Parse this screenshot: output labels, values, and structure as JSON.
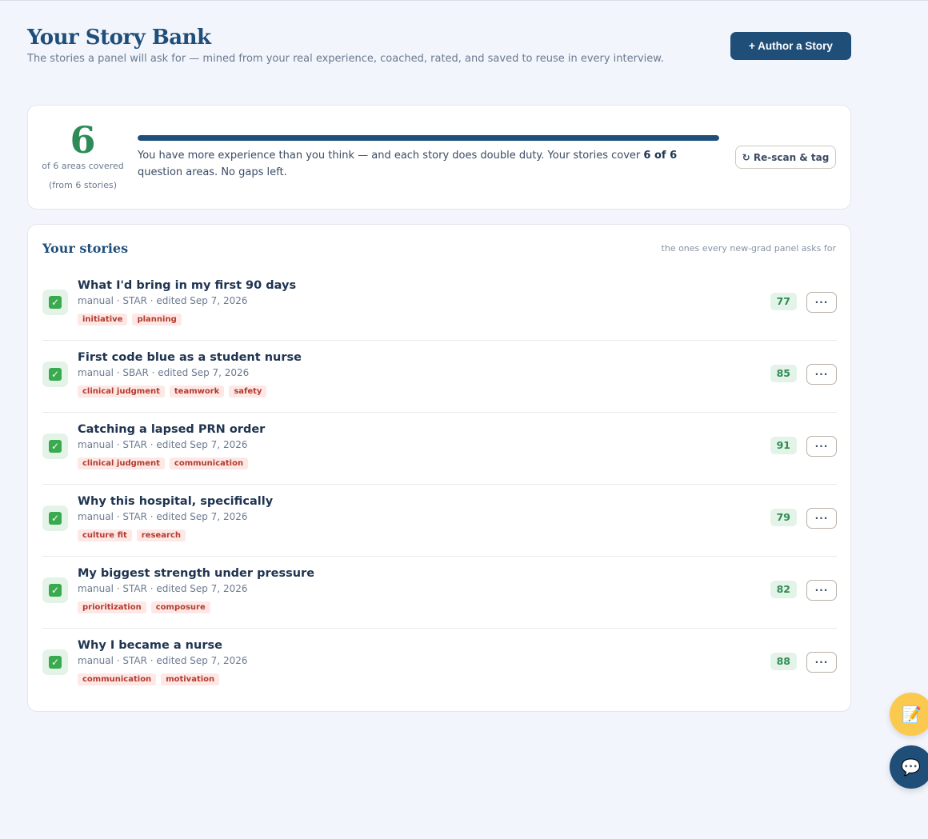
{
  "header": {
    "title": "Your Story Bank",
    "subtitle": "The stories a panel will ask for — mined from your real experience, coached, rated, and saved to reuse in every interview.",
    "author_button": "+ Author a Story"
  },
  "coverage": {
    "covered": "6",
    "areas_text": "of 6 areas covered",
    "from_text": "(from 6 stories)",
    "progress_fraction": 1.0,
    "message_before": "You have more experience than you think — and each story does double duty. Your stories cover ",
    "message_bold": "6 of 6",
    "message_after": " question areas. No gaps left.",
    "rescan_button": "↻ Re-scan & tag"
  },
  "stories": {
    "title": "Your stories",
    "hint": "the ones every new-grad panel asks for",
    "items": [
      {
        "title": "What I'd bring in my first 90 days",
        "meta": "manual · STAR · edited Sep 7, 2026",
        "tags": [
          "initiative",
          "planning"
        ],
        "score": "77"
      },
      {
        "title": "First code blue as a student nurse",
        "meta": "manual · SBAR · edited Sep 7, 2026",
        "tags": [
          "clinical judgment",
          "teamwork",
          "safety"
        ],
        "score": "85"
      },
      {
        "title": "Catching a lapsed PRN order",
        "meta": "manual · STAR · edited Sep 7, 2026",
        "tags": [
          "clinical judgment",
          "communication"
        ],
        "score": "91"
      },
      {
        "title": "Why this hospital, specifically",
        "meta": "manual · STAR · edited Sep 7, 2026",
        "tags": [
          "culture fit",
          "research"
        ],
        "score": "79"
      },
      {
        "title": "My biggest strength under pressure",
        "meta": "manual · STAR · edited Sep 7, 2026",
        "tags": [
          "prioritization",
          "composure"
        ],
        "score": "82"
      },
      {
        "title": "Why I became a nurse",
        "meta": "manual · STAR · edited Sep 7, 2026",
        "tags": [
          "communication",
          "motivation"
        ],
        "score": "88"
      }
    ],
    "check_glyph": "✓",
    "more_glyph": "···"
  },
  "fabs": {
    "notes_icon": "📝",
    "chat_icon": "💬"
  }
}
